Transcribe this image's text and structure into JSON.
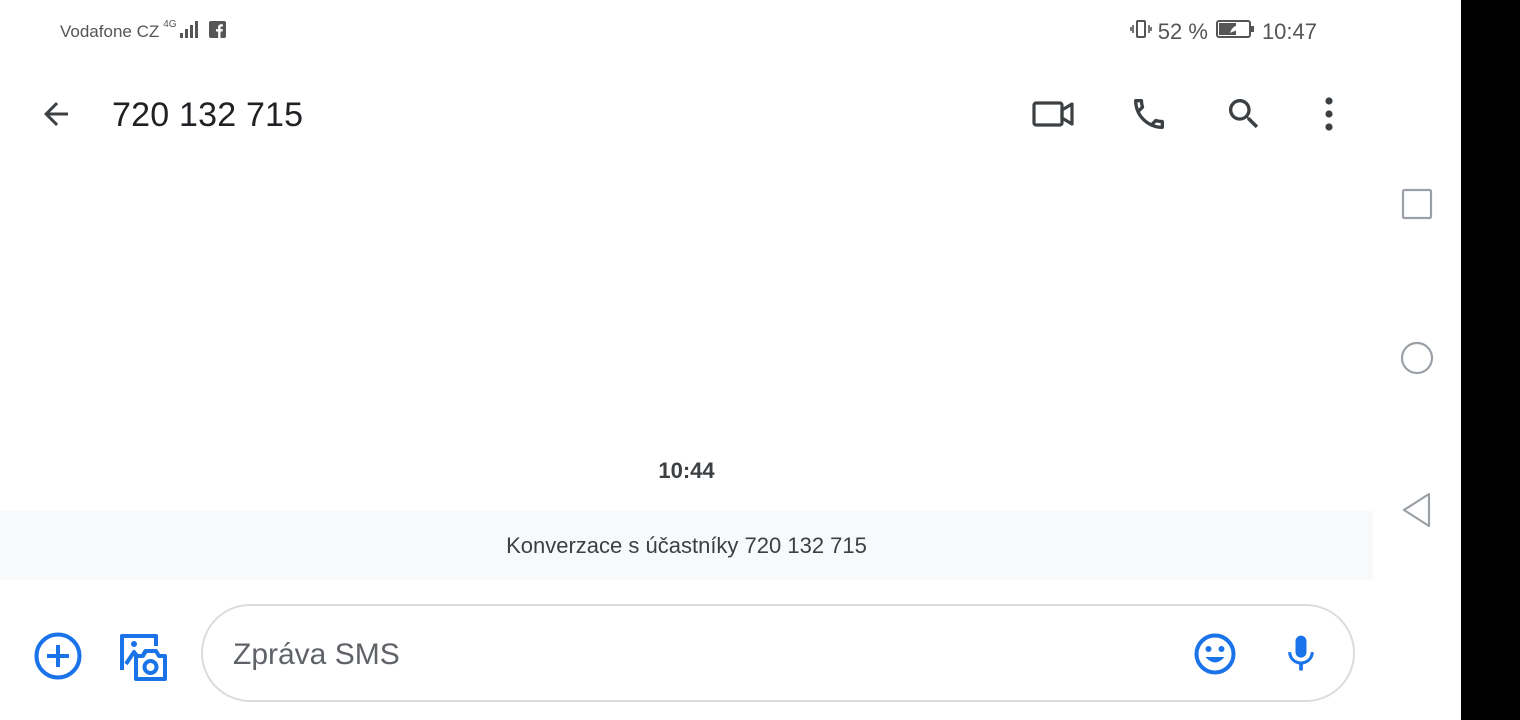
{
  "status_bar": {
    "carrier": "Vodafone CZ",
    "network_type": "4G",
    "battery_percent": "52 %",
    "time": "10:47"
  },
  "app_bar": {
    "title": "720 132 715",
    "icons": [
      "back-arrow-icon",
      "video-call-icon",
      "phone-icon",
      "search-icon",
      "more-vert-icon"
    ]
  },
  "conversation": {
    "timestamp": "10:44",
    "info_text": "Konverzace s účastníky 720 132 715"
  },
  "composer": {
    "placeholder": "Zpráva SMS",
    "value": ""
  },
  "colors": {
    "accent": "#1a73e8",
    "icon_dark": "#3c4043",
    "banner_bg": "#f8f9fa",
    "input_border": "#dadce0"
  }
}
